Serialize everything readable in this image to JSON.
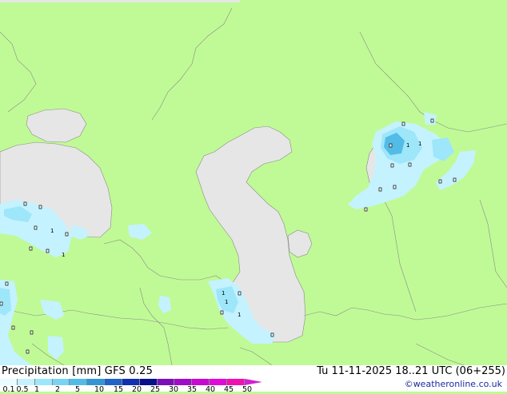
{
  "footer": {
    "title": "Precipitation [mm]  GFS 0.25",
    "valid_time": "Tu 11-11-2025 18..21 UTC (06+255)",
    "credit": "©weatheronline.co.uk"
  },
  "legend": {
    "labels": [
      "0.1",
      "0.5",
      "1",
      "2",
      "5",
      "10",
      "15",
      "20",
      "25",
      "30",
      "35",
      "40",
      "45",
      "50"
    ],
    "colors": [
      "#eafcff",
      "#c4f2ff",
      "#9ee6fa",
      "#78d4f2",
      "#52bce6",
      "#3296d6",
      "#2062c8",
      "#1030b0",
      "#08108a",
      "#7a10b8",
      "#a00cc8",
      "#c80ad0",
      "#e00ad8",
      "#f010b0"
    ]
  },
  "map": {
    "land_color": "#c0fa96",
    "water_color": "#e6e6e6",
    "border_color": "#8a8a8a",
    "cell_values": [
      "1",
      "1",
      "1",
      "1",
      "1",
      "1",
      "1"
    ]
  }
}
